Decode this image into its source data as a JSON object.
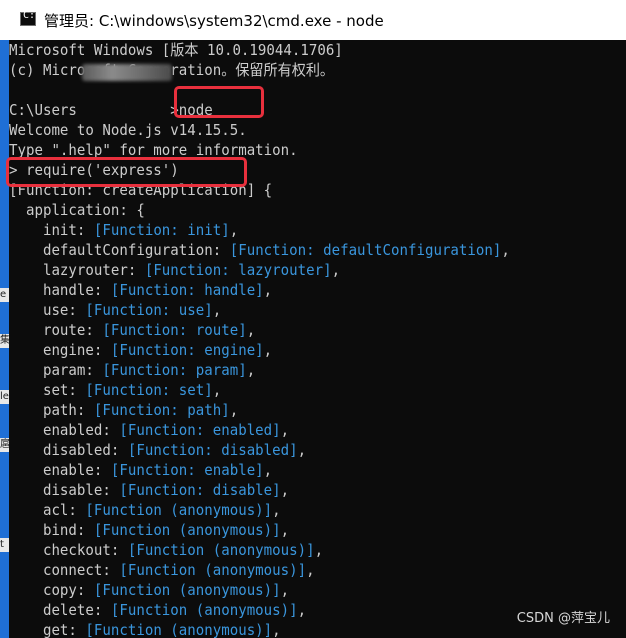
{
  "window": {
    "icon": "cmd-icon",
    "icon_glyph": "C:\\",
    "title": "管理员: C:\\windows\\system32\\cmd.exe - node"
  },
  "left_strip": {
    "glyphs": [
      "e",
      "集",
      "le",
      "扈",
      "t"
    ]
  },
  "console": {
    "lines": [
      [
        {
          "t": "Microsoft Windows [版本 10.0.19044.1706]"
        }
      ],
      [
        {
          "t": "(c) Microsoft Corporation。保留所有权利。"
        }
      ],
      [
        {
          "t": ""
        }
      ],
      [
        {
          "t": "C:\\Users           >node"
        }
      ],
      [
        {
          "t": "Welcome to Node.js v14.15.5."
        }
      ],
      [
        {
          "t": "Type \".help\" for more information."
        }
      ],
      [
        {
          "t": "> require('express')"
        }
      ],
      [
        {
          "t": "[Function: createApplication] {"
        }
      ],
      [
        {
          "t": "  application: {"
        }
      ],
      [
        {
          "t": "    init: "
        },
        {
          "t": "[Function: init]",
          "c": "fn"
        },
        {
          "t": ","
        }
      ],
      [
        {
          "t": "    defaultConfiguration: "
        },
        {
          "t": "[Function: defaultConfiguration]",
          "c": "fn"
        },
        {
          "t": ","
        }
      ],
      [
        {
          "t": "    lazyrouter: "
        },
        {
          "t": "[Function: lazyrouter]",
          "c": "fn"
        },
        {
          "t": ","
        }
      ],
      [
        {
          "t": "    handle: "
        },
        {
          "t": "[Function: handle]",
          "c": "fn"
        },
        {
          "t": ","
        }
      ],
      [
        {
          "t": "    use: "
        },
        {
          "t": "[Function: use]",
          "c": "fn"
        },
        {
          "t": ","
        }
      ],
      [
        {
          "t": "    route: "
        },
        {
          "t": "[Function: route]",
          "c": "fn"
        },
        {
          "t": ","
        }
      ],
      [
        {
          "t": "    engine: "
        },
        {
          "t": "[Function: engine]",
          "c": "fn"
        },
        {
          "t": ","
        }
      ],
      [
        {
          "t": "    param: "
        },
        {
          "t": "[Function: param]",
          "c": "fn"
        },
        {
          "t": ","
        }
      ],
      [
        {
          "t": "    set: "
        },
        {
          "t": "[Function: set]",
          "c": "fn"
        },
        {
          "t": ","
        }
      ],
      [
        {
          "t": "    path: "
        },
        {
          "t": "[Function: path]",
          "c": "fn"
        },
        {
          "t": ","
        }
      ],
      [
        {
          "t": "    enabled: "
        },
        {
          "t": "[Function: enabled]",
          "c": "fn"
        },
        {
          "t": ","
        }
      ],
      [
        {
          "t": "    disabled: "
        },
        {
          "t": "[Function: disabled]",
          "c": "fn"
        },
        {
          "t": ","
        }
      ],
      [
        {
          "t": "    enable: "
        },
        {
          "t": "[Function: enable]",
          "c": "fn"
        },
        {
          "t": ","
        }
      ],
      [
        {
          "t": "    disable: "
        },
        {
          "t": "[Function: disable]",
          "c": "fn"
        },
        {
          "t": ","
        }
      ],
      [
        {
          "t": "    acl: "
        },
        {
          "t": "[Function (anonymous)]",
          "c": "fn"
        },
        {
          "t": ","
        }
      ],
      [
        {
          "t": "    bind: "
        },
        {
          "t": "[Function (anonymous)]",
          "c": "fn"
        },
        {
          "t": ","
        }
      ],
      [
        {
          "t": "    checkout: "
        },
        {
          "t": "[Function (anonymous)]",
          "c": "fn"
        },
        {
          "t": ","
        }
      ],
      [
        {
          "t": "    connect: "
        },
        {
          "t": "[Function (anonymous)]",
          "c": "fn"
        },
        {
          "t": ","
        }
      ],
      [
        {
          "t": "    copy: "
        },
        {
          "t": "[Function (anonymous)]",
          "c": "fn"
        },
        {
          "t": ","
        }
      ],
      [
        {
          "t": "    delete: "
        },
        {
          "t": "[Function (anonymous)]",
          "c": "fn"
        },
        {
          "t": ","
        }
      ],
      [
        {
          "t": "    get: "
        },
        {
          "t": "[Function (anonymous)]",
          "c": "fn"
        },
        {
          "t": ","
        }
      ]
    ]
  },
  "watermark": "CSDN @萍宝儿",
  "colors": {
    "console_bg": "#0c0c0c",
    "console_text": "#cccccc",
    "function_text": "#3a96dd",
    "highlight_box": "#e8303d",
    "left_strip": "#1f6fd6"
  }
}
